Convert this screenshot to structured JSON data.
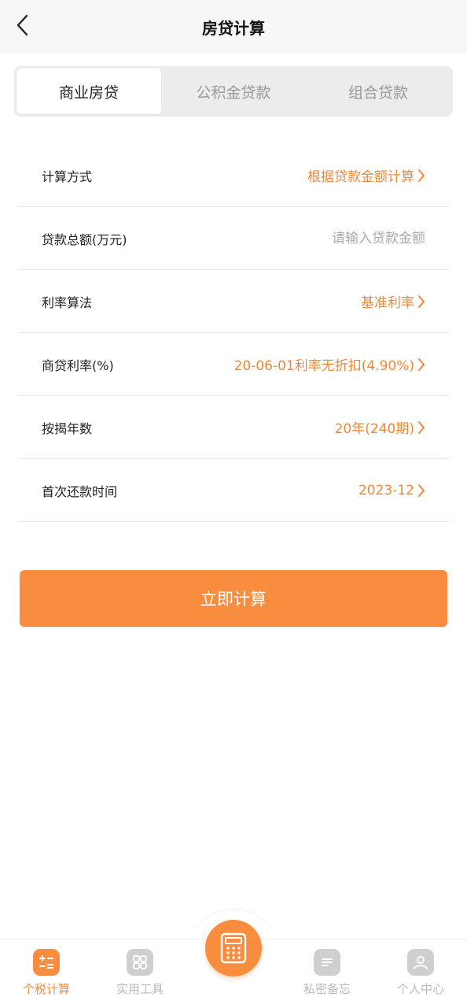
{
  "header": {
    "title": "房贷计算"
  },
  "tabs": [
    {
      "label": "商业房贷",
      "active": true
    },
    {
      "label": "公积金贷款",
      "active": false
    },
    {
      "label": "组合贷款",
      "active": false
    }
  ],
  "form": {
    "method": {
      "label": "计算方式",
      "value": "根据贷款金额计算"
    },
    "amount": {
      "label": "贷款总额(万元)",
      "placeholder": "请输入贷款金额",
      "value": ""
    },
    "rate_method": {
      "label": "利率算法",
      "value": "基准利率"
    },
    "rate": {
      "label": "商贷利率(%)",
      "value": "20-06-01利率无折扣(4.90%)"
    },
    "years": {
      "label": "按揭年数",
      "value": "20年(240期)"
    },
    "first_payment": {
      "label": "首次还款时间",
      "value": "2023-12"
    }
  },
  "calculate_button": {
    "label": "立即计算"
  },
  "tabbar": {
    "items": [
      {
        "label": "个税计算",
        "icon": "calculator-icon",
        "active": true
      },
      {
        "label": "实用工具",
        "icon": "grid-icon",
        "active": false
      },
      {
        "label": "私密备忘",
        "icon": "note-icon",
        "active": false
      },
      {
        "label": "个人中心",
        "icon": "user-icon",
        "active": false
      }
    ],
    "center_icon": "calculator-icon"
  },
  "colors": {
    "accent": "#f98d3f",
    "value_text": "#f0883a",
    "inactive": "#cfcfcf"
  }
}
